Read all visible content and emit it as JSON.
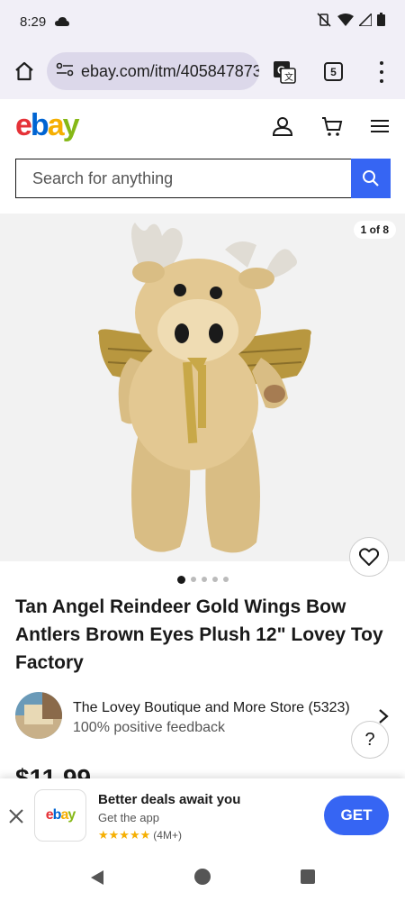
{
  "status": {
    "time": "8:29"
  },
  "browser": {
    "url": "ebay.com/itm/405847873",
    "tab_count": "5"
  },
  "header": {
    "logo": [
      "e",
      "b",
      "a",
      "y"
    ],
    "colors": {
      "e": "#e53238",
      "b": "#0064d2",
      "a": "#f5af02",
      "y": "#86b817"
    }
  },
  "search": {
    "placeholder": "Search for anything"
  },
  "gallery": {
    "counter": "1 of 8",
    "dots": 5,
    "active_dot": 0
  },
  "product": {
    "title": "Tan Angel Reindeer Gold Wings Bow Antlers Brown Eyes Plush 12\" Lovey Toy Factory",
    "price": "$11.99"
  },
  "seller": {
    "name": "The Lovey Boutique and More Store (5323)",
    "feedback": "100% positive feedback"
  },
  "help": {
    "label": "?"
  },
  "app_banner": {
    "title": "Better deals await you",
    "subtitle": "Get the app",
    "stars": "★★★★★",
    "reviews": "(4M+)",
    "cta": "GET"
  },
  "accent_color": "#3665f3"
}
